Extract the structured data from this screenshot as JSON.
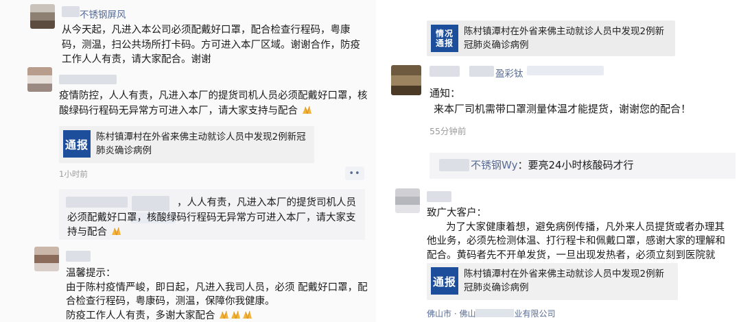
{
  "left": {
    "post1": {
      "name": "不锈钢屏风",
      "text": "从今天起，凡进入本公司必须配戴好口罩，配合检查行程码，粤康码，测温，扫公共场所打卡码。方可进入本厂区域。谢谢合作，防疫工作人人有责，请大家配合。谢谢"
    },
    "post2": {
      "text": "疫情防控，人人有责，凡进入本厂的提货司机人员必须配戴好口罩，核酸绿码行程码无异常方可进入本厂，请大家支持与配合",
      "card_logo": "通报",
      "card_title": "陈村镇潭村在外省来佛主动就诊人员中发现2例新冠肺炎确诊病例",
      "time": "1小时前",
      "more": "••"
    },
    "comment": {
      "text": "，人人有责，凡进入本厂的提货司机人员必须配戴好口罩，核酸绿码行程码无异常方可进入本厂，请大家支持与配合"
    },
    "post3": {
      "lines": [
        "温馨提示：",
        "由于陈村疫情严峻，即日起，凡进入我司人员，必须 配戴好口罩，配合检查行程码，粤康码，测温，保障你我健康。",
        "防疫工作人人有责，多谢大家配合"
      ]
    }
  },
  "right": {
    "top_card": {
      "logo_line1": "情况",
      "logo_line2": "通报",
      "title": "陈村镇潭村在外省来佛主动就诊人员中发现2例新冠肺炎确诊病例"
    },
    "post1": {
      "name": "盈彩钛",
      "line1": "通知：",
      "line2": "来本厂司机需带口罩测量体温才能提货，谢谢您的配合！",
      "time": "55分钟前"
    },
    "comment": {
      "name": "不锈钢Wy",
      "sep": "：",
      "text": "要亮24小时核酸码才行"
    },
    "post2": {
      "line1": "致广大客户：",
      "body": "为了大家健康着想，避免病例传播，凡外来人员提货或者办理其他业务，必须先检测体温、打行程卡和佩戴口罩，感谢大家的理解和配合。黄码者先不开单发货，一旦出现发热者，必须立刻到医院就诊。",
      "card_logo": "通报",
      "card_title": "陈村镇潭村在外省来佛主动就诊人员中发现2例新冠肺炎确诊病例",
      "location_a": "佛山市 · 佛山",
      "location_b": "业有限公司"
    }
  },
  "colors": {
    "link": "#576b95",
    "logo_blue": "#1c4e9b",
    "card_bg": "#f0f0f0",
    "meta": "#9b9b9b"
  }
}
